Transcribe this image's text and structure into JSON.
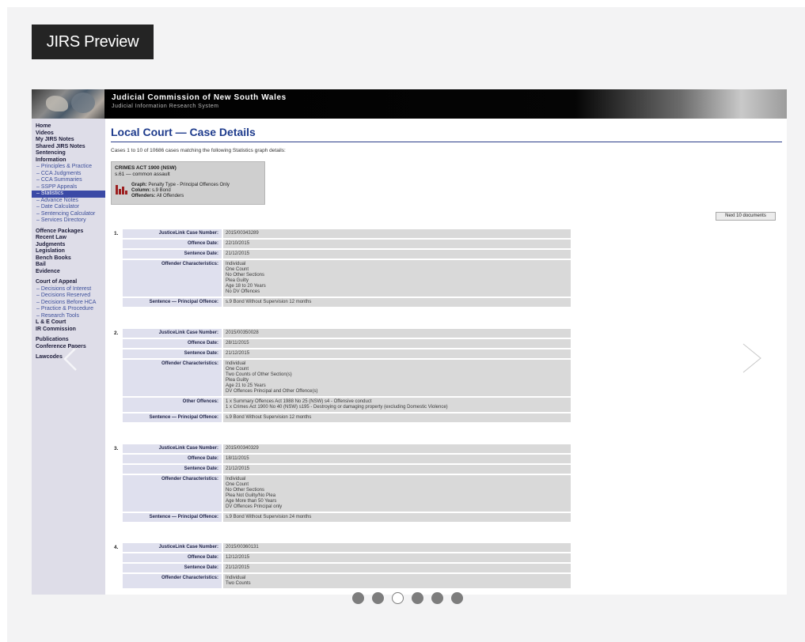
{
  "preview_title": "JIRS Preview",
  "banner": {
    "title": "Judicial Commission of New South Wales",
    "subtitle": "Judicial Information Research System"
  },
  "sidebar": [
    {
      "label": "Home",
      "style": "bold"
    },
    {
      "label": "Videos",
      "style": "bold"
    },
    {
      "label": "My JIRS Notes",
      "style": "bold"
    },
    {
      "label": "Shared JIRS Notes",
      "style": "bold"
    },
    {
      "label": "Sentencing",
      "style": "bold"
    },
    {
      "label": "Information",
      "style": "bold"
    },
    {
      "label": "– Principles & Practice",
      "style": "sub"
    },
    {
      "label": "– CCA Judgments",
      "style": "sub"
    },
    {
      "label": "– CCA Summaries",
      "style": "sub"
    },
    {
      "label": "– SSPP Appeals",
      "style": "sub"
    },
    {
      "label": "– Statistics",
      "style": "sel"
    },
    {
      "label": "– Advance Notes",
      "style": "sub"
    },
    {
      "label": "– Date Calculator",
      "style": "sub"
    },
    {
      "label": "– Sentencing Calculator",
      "style": "sub"
    },
    {
      "label": "– Services Directory",
      "style": "sub"
    },
    {
      "label": "",
      "style": "gap"
    },
    {
      "label": "Offence Packages",
      "style": "bold"
    },
    {
      "label": "Recent Law",
      "style": "bold"
    },
    {
      "label": "Judgments",
      "style": "bold"
    },
    {
      "label": "Legislation",
      "style": "bold"
    },
    {
      "label": "Bench Books",
      "style": "bold"
    },
    {
      "label": "Bail",
      "style": "bold"
    },
    {
      "label": "Evidence",
      "style": "bold"
    },
    {
      "label": "",
      "style": "gap"
    },
    {
      "label": "Court of Appeal",
      "style": "bold"
    },
    {
      "label": "– Decisions of Interest",
      "style": "sub"
    },
    {
      "label": "– Decisions Reserved",
      "style": "sub"
    },
    {
      "label": "– Decisions Before HCA",
      "style": "sub"
    },
    {
      "label": "– Practice & Procedure",
      "style": "sub"
    },
    {
      "label": "– Research Tools",
      "style": "sub"
    },
    {
      "label": "L & E Court",
      "style": "bold"
    },
    {
      "label": "IR Commission",
      "style": "bold"
    },
    {
      "label": "",
      "style": "gap"
    },
    {
      "label": "Publications",
      "style": "bold"
    },
    {
      "label": "Conference Papers",
      "style": "bold"
    },
    {
      "label": "",
      "style": "gap"
    },
    {
      "label": "Lawcodes",
      "style": "bold"
    }
  ],
  "page": {
    "title": "Local Court — Case Details",
    "results_line": "Cases 1 to 10 of 10686 cases matching the following Statistics graph details:",
    "filter": {
      "act": "CRIMES ACT 1900 (NSW)",
      "section": "s.61 — common assault",
      "graph_label": "Graph:",
      "graph_value": "Penalty Type - Principal Offences Only",
      "column_label": "Column:",
      "column_value": "s.9 Bond",
      "offenders_label": "Offenders:",
      "offenders_value": "All Offenders"
    },
    "next_button": "Next 10 documents"
  },
  "cases": [
    {
      "num": "1.",
      "rows": [
        {
          "label": "JusticeLink Case Number:",
          "value": "2015/00343289"
        },
        {
          "label": "Offence Date:",
          "value": "22/10/2015"
        },
        {
          "label": "Sentence Date:",
          "value": "21/12/2015"
        },
        {
          "label": "Offender Characteristics:",
          "lines": [
            "Individual",
            "One Count",
            "No Other Sections",
            "Plea Guilty",
            "Age 18 to 20 Years",
            "No DV Offences"
          ]
        },
        {
          "label": "Sentence — Principal Offence:",
          "value": "s.9 Bond Without Supervision 12 months"
        }
      ]
    },
    {
      "num": "2.",
      "rows": [
        {
          "label": "JusticeLink Case Number:",
          "value": "2015/00350028"
        },
        {
          "label": "Offence Date:",
          "value": "28/11/2015"
        },
        {
          "label": "Sentence Date:",
          "value": "21/12/2015"
        },
        {
          "label": "Offender Characteristics:",
          "lines": [
            "Individual",
            "One Count",
            "Two Counts of Other Section(s)",
            "Plea Guilty",
            "Age 21 to 25 Years",
            "DV Offences Principal and Other Offence(s)"
          ]
        },
        {
          "label": "Other Offences:",
          "lines": [
            "1 x Summary Offences Act 1988 No 25 (NSW) s4 - Offensive conduct",
            "1 x Crimes Act 1900 No 40 (NSW) s195 - Destroying or damaging property (excluding Domestic Violence)"
          ]
        },
        {
          "label": "Sentence — Principal Offence:",
          "value": "s.9 Bond Without Supervision 12 months"
        }
      ]
    },
    {
      "num": "3.",
      "rows": [
        {
          "label": "JusticeLink Case Number:",
          "value": "2015/00340329"
        },
        {
          "label": "Offence Date:",
          "value": "18/11/2015"
        },
        {
          "label": "Sentence Date:",
          "value": "21/12/2015"
        },
        {
          "label": "Offender Characteristics:",
          "lines": [
            "Individual",
            "One Count",
            "No Other Sections",
            "Plea Not Guilty/No Plea",
            "Age More than 50 Years",
            "DV Offences Principal only"
          ]
        },
        {
          "label": "Sentence — Principal Offence:",
          "value": "s.9 Bond Without Supervision 24 months"
        }
      ]
    },
    {
      "num": "4.",
      "rows": [
        {
          "label": "JusticeLink Case Number:",
          "value": "2015/00360131"
        },
        {
          "label": "Offence Date:",
          "value": "12/12/2015"
        },
        {
          "label": "Sentence Date:",
          "value": "21/12/2015"
        },
        {
          "label": "Offender Characteristics:",
          "lines": [
            "Individual",
            "Two Counts"
          ]
        }
      ]
    }
  ],
  "carousel": {
    "count": 6,
    "active_index": 2
  }
}
